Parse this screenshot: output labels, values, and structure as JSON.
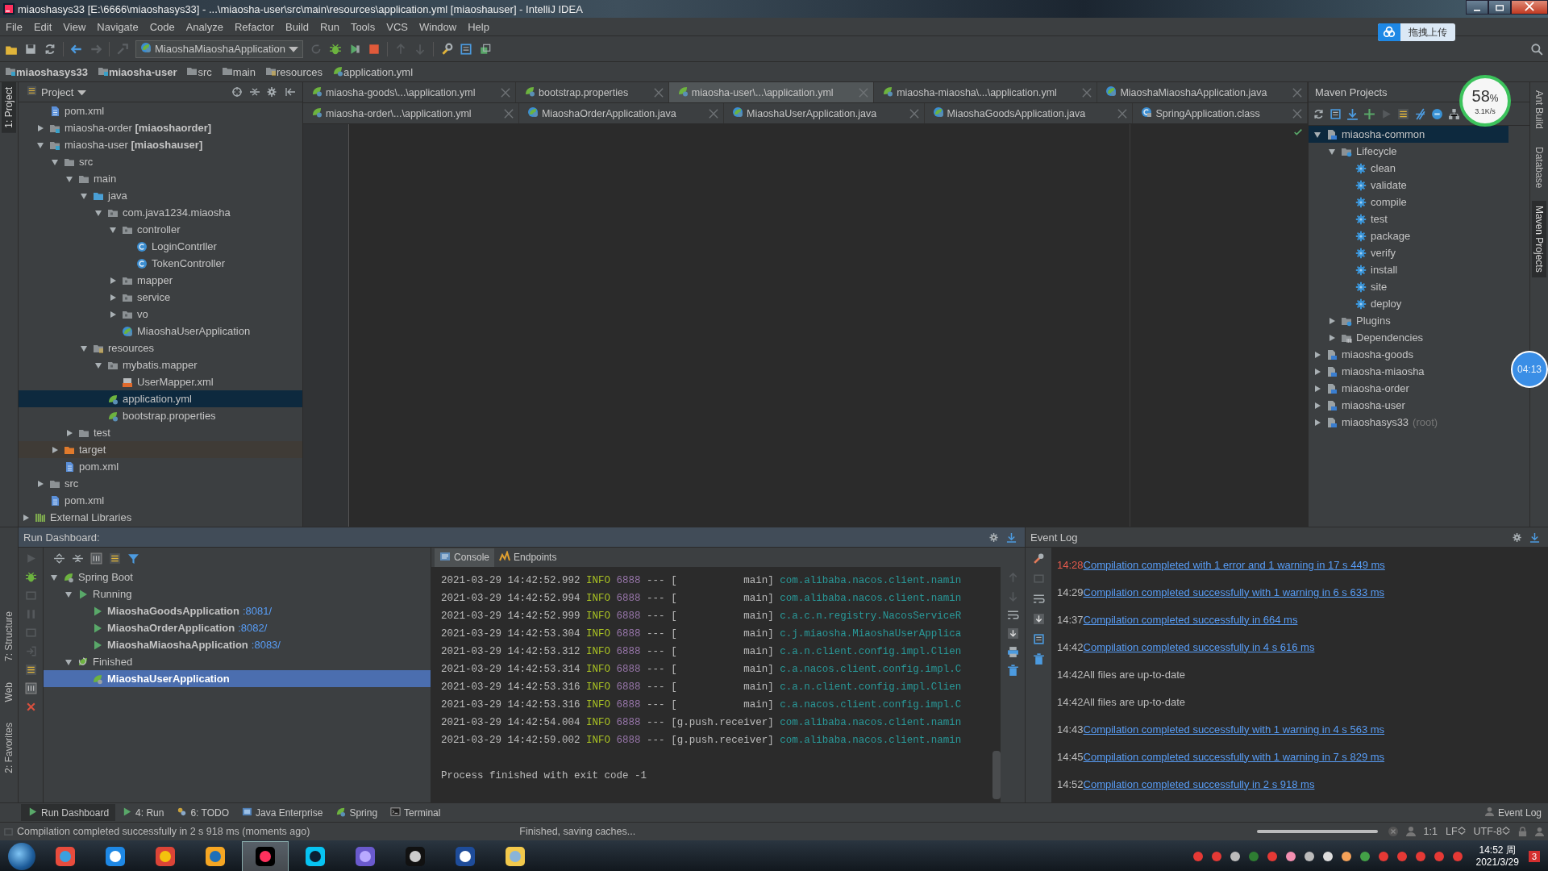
{
  "window": {
    "title": "miaoshasys33 [E:\\6666\\miaoshasys33] - ...\\miaosha-user\\src\\main\\resources\\application.yml [miaoshauser] - IntelliJ IDEA"
  },
  "menu": [
    "File",
    "Edit",
    "View",
    "Navigate",
    "Code",
    "Analyze",
    "Refactor",
    "Build",
    "Run",
    "Tools",
    "VCS",
    "Window",
    "Help"
  ],
  "toolbar": {
    "run_configuration": "MiaoshaMiaoshaApplication",
    "upload_button": "拖拽上传"
  },
  "network_meter": {
    "percent": "58",
    "unit": "%",
    "speed": "3.1K/s"
  },
  "breadcrumb": [
    {
      "label": "miaoshasys33",
      "kind": "module"
    },
    {
      "label": "miaosha-user",
      "kind": "module"
    },
    {
      "label": "src",
      "kind": "folder"
    },
    {
      "label": "main",
      "kind": "folder"
    },
    {
      "label": "resources",
      "kind": "resources"
    },
    {
      "label": "application.yml",
      "kind": "spring"
    }
  ],
  "left_stripe": {
    "top": [
      {
        "label": "1: Project",
        "selected": true
      }
    ],
    "bottom": [
      {
        "label": "7: Structure",
        "selected": false
      },
      {
        "label": "Web",
        "selected": false
      },
      {
        "label": "2: Favorites",
        "selected": false
      }
    ]
  },
  "right_stripe": [
    {
      "label": "Ant Build",
      "selected": false
    },
    {
      "label": "Database",
      "selected": false
    },
    {
      "label": "Maven Projects",
      "selected": true
    }
  ],
  "project": {
    "title": "Project",
    "tree": [
      {
        "label": "pom.xml",
        "kind": "pom",
        "selected": false
      },
      {
        "label": "miaosha-order **[miaoshaorder]**",
        "kind": "module",
        "expanded": false,
        "selected": false
      },
      {
        "label": "miaosha-user **[miaoshauser]**",
        "kind": "module",
        "expanded": true,
        "selected": false,
        "children": [
          {
            "label": "src",
            "kind": "folder",
            "expanded": true,
            "selected": false,
            "children": [
              {
                "label": "main",
                "kind": "folder",
                "expanded": true,
                "selected": false,
                "children": [
                  {
                    "label": "java",
                    "kind": "source",
                    "expanded": true,
                    "selected": false,
                    "children": [
                      {
                        "label": "com.java1234.miaosha",
                        "kind": "package",
                        "expanded": true,
                        "selected": false,
                        "children": [
                          {
                            "label": "controller",
                            "kind": "package",
                            "expanded": true,
                            "selected": false,
                            "children": [
                              {
                                "label": "LoginContrller",
                                "kind": "class",
                                "selected": false
                              },
                              {
                                "label": "TokenController",
                                "kind": "class",
                                "selected": false
                              }
                            ]
                          },
                          {
                            "label": "mapper",
                            "kind": "package",
                            "expanded": false,
                            "selected": false
                          },
                          {
                            "label": "service",
                            "kind": "package",
                            "expanded": false,
                            "selected": false
                          },
                          {
                            "label": "vo",
                            "kind": "package",
                            "expanded": false,
                            "selected": false
                          },
                          {
                            "label": "MiaoshaUserApplication",
                            "kind": "spring-class",
                            "selected": false
                          }
                        ]
                      }
                    ]
                  },
                  {
                    "label": "resources",
                    "kind": "resources",
                    "expanded": true,
                    "selected": false,
                    "children": [
                      {
                        "label": "mybatis.mapper",
                        "kind": "package",
                        "expanded": true,
                        "selected": false,
                        "children": [
                          {
                            "label": "UserMapper.xml",
                            "kind": "xml",
                            "selected": false
                          }
                        ]
                      },
                      {
                        "label": "application.yml",
                        "kind": "spring",
                        "selected": true
                      },
                      {
                        "label": "bootstrap.properties",
                        "kind": "spring",
                        "selected": false
                      }
                    ]
                  }
                ]
              },
              {
                "label": "test",
                "kind": "folder",
                "expanded": false,
                "selected": false
              }
            ]
          },
          {
            "label": "target",
            "kind": "excluded",
            "expanded": false,
            "selected": false
          },
          {
            "label": "pom.xml",
            "kind": "pom",
            "selected": false
          }
        ]
      },
      {
        "label": "src",
        "kind": "folder",
        "expanded": false,
        "selected": false
      },
      {
        "label": "pom.xml",
        "kind": "pom",
        "selected": false
      }
    ],
    "libraries": {
      "label": "External Libraries",
      "kind": "library",
      "expanded": false,
      "selected": false
    }
  },
  "editor_tabs": [
    [
      {
        "label": "miaosha-goods\\...\\application.yml",
        "kind": "spring",
        "selected": false
      },
      {
        "label": "bootstrap.properties",
        "kind": "spring",
        "selected": false
      },
      {
        "label": "miaosha-user\\...\\application.yml",
        "kind": "spring",
        "selected": true
      },
      {
        "label": "miaosha-miaosha\\...\\application.yml",
        "kind": "spring",
        "selected": false
      },
      {
        "label": "MiaoshaMiaoshaApplication.java",
        "kind": "spring-class",
        "selected": false
      }
    ],
    [
      {
        "label": "miaosha-order\\...\\application.yml",
        "kind": "spring",
        "selected": false
      },
      {
        "label": "MiaoshaOrderApplication.java",
        "kind": "spring-class",
        "selected": false
      },
      {
        "label": "MiaoshaUserApplication.java",
        "kind": "spring-class",
        "selected": false
      },
      {
        "label": "MiaoshaGoodsApplication.java",
        "kind": "spring-class",
        "selected": false
      },
      {
        "label": "SpringApplication.class",
        "kind": "class-file",
        "selected": false
      }
    ]
  ],
  "maven": {
    "title": "Maven Projects",
    "tree": [
      {
        "label": "miaosha-common",
        "kind": "maven-module",
        "expanded": true,
        "selected": true,
        "children": [
          {
            "label": "Lifecycle",
            "kind": "lifecycle",
            "expanded": true,
            "selected": false,
            "children": [
              {
                "label": "clean",
                "kind": "gear",
                "selected": false
              },
              {
                "label": "validate",
                "kind": "gear",
                "selected": false
              },
              {
                "label": "compile",
                "kind": "gear",
                "selected": false
              },
              {
                "label": "test",
                "kind": "gear",
                "selected": false
              },
              {
                "label": "package",
                "kind": "gear",
                "selected": false
              },
              {
                "label": "verify",
                "kind": "gear",
                "selected": false
              },
              {
                "label": "install",
                "kind": "gear",
                "selected": false
              },
              {
                "label": "site",
                "kind": "gear",
                "selected": false
              },
              {
                "label": "deploy",
                "kind": "gear",
                "selected": false
              }
            ]
          },
          {
            "label": "Plugins",
            "kind": "lifecycle",
            "expanded": false,
            "selected": false
          },
          {
            "label": "Dependencies",
            "kind": "dependencies",
            "expanded": false,
            "selected": false
          }
        ]
      },
      {
        "label": "miaosha-goods",
        "kind": "maven-module",
        "expanded": false,
        "selected": false
      },
      {
        "label": "miaosha-miaosha",
        "kind": "maven-module",
        "expanded": false,
        "selected": false
      },
      {
        "label": "miaosha-order",
        "kind": "maven-module",
        "expanded": false,
        "selected": false
      },
      {
        "label": "miaosha-user",
        "kind": "maven-module",
        "expanded": false,
        "selected": false
      },
      {
        "label": "miaoshasys33",
        "note": "(root)",
        "kind": "maven-module",
        "expanded": false,
        "selected": false
      }
    ]
  },
  "timer": "04:13",
  "run_dashboard": {
    "title": "Run Dashboard:",
    "tree": [
      {
        "label": "Spring Boot",
        "kind": "spring-boot",
        "expanded": true,
        "selected": false,
        "children": [
          {
            "label": "Running",
            "kind": "run",
            "expanded": true,
            "selected": false,
            "children": [
              {
                "label": "MiaoshaGoodsApplication",
                "port": ":8081/",
                "kind": "run",
                "selected": false
              },
              {
                "label": "MiaoshaOrderApplication",
                "port": ":8082/",
                "kind": "run",
                "selected": false
              },
              {
                "label": "MiaoshaMiaoshaApplication",
                "port": ":8083/",
                "kind": "run",
                "selected": false
              }
            ]
          },
          {
            "label": "Finished",
            "kind": "finished",
            "expanded": true,
            "selected": false,
            "children": [
              {
                "label": "MiaoshaUserApplication",
                "kind": "spring-boot",
                "selected": true
              }
            ]
          }
        ]
      }
    ]
  },
  "console": {
    "tabs": [
      {
        "label": "Console",
        "kind": "console",
        "selected": true
      },
      {
        "label": "Endpoints",
        "kind": "endpoints",
        "selected": false
      }
    ],
    "lines": [
      {
        "timestamp": "2021-03-29 14:42:52.992",
        "level": "INFO",
        "pid": "6888",
        "separator": "---",
        "thread": "[           main]",
        "logger": "com.alibaba.nacos.client.namin"
      },
      {
        "timestamp": "2021-03-29 14:42:52.994",
        "level": "INFO",
        "pid": "6888",
        "separator": "---",
        "thread": "[           main]",
        "logger": "com.alibaba.nacos.client.namin"
      },
      {
        "timestamp": "2021-03-29 14:42:52.999",
        "level": "INFO",
        "pid": "6888",
        "separator": "---",
        "thread": "[           main]",
        "logger": "c.a.c.n.registry.NacosServiceR"
      },
      {
        "timestamp": "2021-03-29 14:42:53.304",
        "level": "INFO",
        "pid": "6888",
        "separator": "---",
        "thread": "[           main]",
        "logger": "c.j.miaosha.MiaoshaUserApplica"
      },
      {
        "timestamp": "2021-03-29 14:42:53.312",
        "level": "INFO",
        "pid": "6888",
        "separator": "---",
        "thread": "[           main]",
        "logger": "c.a.n.client.config.impl.Clien"
      },
      {
        "timestamp": "2021-03-29 14:42:53.314",
        "level": "INFO",
        "pid": "6888",
        "separator": "---",
        "thread": "[           main]",
        "logger": "c.a.nacos.client.config.impl.C"
      },
      {
        "timestamp": "2021-03-29 14:42:53.316",
        "level": "INFO",
        "pid": "6888",
        "separator": "---",
        "thread": "[           main]",
        "logger": "c.a.n.client.config.impl.Clien"
      },
      {
        "timestamp": "2021-03-29 14:42:53.316",
        "level": "INFO",
        "pid": "6888",
        "separator": "---",
        "thread": "[           main]",
        "logger": "c.a.nacos.client.config.impl.C"
      },
      {
        "timestamp": "2021-03-29 14:42:54.004",
        "level": "INFO",
        "pid": "6888",
        "separator": "---",
        "thread": "[g.push.receiver]",
        "logger": "com.alibaba.nacos.client.namin"
      },
      {
        "timestamp": "2021-03-29 14:42:59.002",
        "level": "INFO",
        "pid": "6888",
        "separator": "---",
        "thread": "[g.push.receiver]",
        "logger": "com.alibaba.nacos.client.namin"
      }
    ],
    "exit_message": "Process finished with exit code -1"
  },
  "event_log": {
    "title": "Event Log",
    "entries": [
      {
        "time": "14:28",
        "message": "Compilation completed with 1 error and 1 warning in 17 s 449 ms",
        "link": true,
        "error": true
      },
      {
        "time": "14:29",
        "message": "Compilation completed successfully with 1 warning in 6 s 633 ms",
        "link": true,
        "error": false
      },
      {
        "time": "14:37",
        "message": "Compilation completed successfully in 664 ms",
        "link": true,
        "error": false
      },
      {
        "time": "14:42",
        "message": "Compilation completed successfully in 4 s 616 ms",
        "link": true,
        "error": false
      },
      {
        "time": "14:42",
        "message": "All files are up-to-date",
        "link": false,
        "error": false
      },
      {
        "time": "14:42",
        "message": "All files are up-to-date",
        "link": false,
        "error": false
      },
      {
        "time": "14:43",
        "message": "Compilation completed successfully with 1 warning in 4 s 563 ms",
        "link": true,
        "error": false
      },
      {
        "time": "14:45",
        "message": "Compilation completed successfully with 1 warning in 7 s 829 ms",
        "link": true,
        "error": false
      },
      {
        "time": "14:52",
        "message": "Compilation completed successfully in 2 s 918 ms",
        "link": true,
        "error": false
      }
    ]
  },
  "tool_windows": [
    {
      "label": "Run Dashboard",
      "kind": "run",
      "selected": true
    },
    {
      "label": "4: Run",
      "kind": "run",
      "selected": false
    },
    {
      "label": "6: TODO",
      "kind": "todo",
      "selected": false
    },
    {
      "label": "Java Enterprise",
      "kind": "enterprise",
      "selected": false
    },
    {
      "label": "Spring",
      "kind": "spring",
      "selected": false
    },
    {
      "label": "Terminal",
      "kind": "terminal",
      "selected": false
    }
  ],
  "event_log_button": "Event Log",
  "status_bar": {
    "message": "Compilation completed successfully in 2 s 918 ms (moments ago)",
    "progress": "Finished, saving caches...",
    "position": "1:1",
    "line_separator": "LF",
    "encoding": "UTF-8"
  },
  "taskbar": {
    "apps": [
      {
        "kind": "flower",
        "active": false
      },
      {
        "kind": "browser",
        "active": false
      },
      {
        "kind": "chrome",
        "active": false
      },
      {
        "kind": "vm",
        "active": false
      },
      {
        "kind": "idea",
        "active": true
      },
      {
        "kind": "webstorm",
        "active": false
      },
      {
        "kind": "dolphin",
        "active": false
      },
      {
        "kind": "cmd",
        "active": false
      },
      {
        "kind": "dark-app",
        "active": false
      },
      {
        "kind": "explorer",
        "active": false
      }
    ],
    "time": "14:52 周",
    "date": "2021/3/29",
    "notifications": "3"
  }
}
